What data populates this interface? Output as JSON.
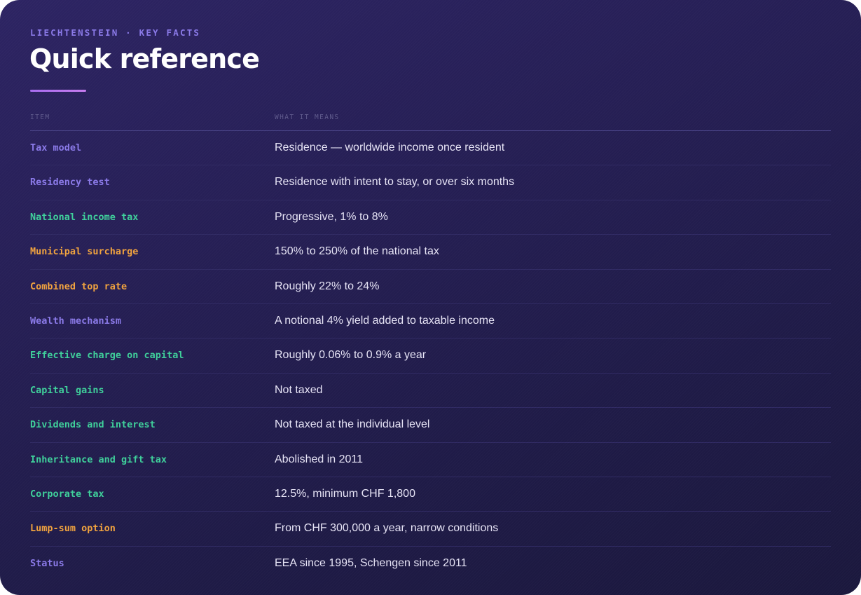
{
  "colors": {
    "purple": "#8a79e8",
    "green": "#3ecf9a",
    "orange": "#f0a23e",
    "accent_rule": "#b074f0"
  },
  "header": {
    "eyebrow": "LIECHTENSTEIN · KEY FACTS",
    "title": "Quick reference"
  },
  "table": {
    "columns": [
      "ITEM",
      "WHAT IT MEANS"
    ],
    "rows": [
      {
        "item": "Tax model",
        "meaning": "Residence — worldwide income once resident",
        "color": "#8a79e8"
      },
      {
        "item": "Residency test",
        "meaning": "Residence with intent to stay, or over six months",
        "color": "#8a79e8"
      },
      {
        "item": "National income tax",
        "meaning": "Progressive, 1% to 8%",
        "color": "#3ecf9a"
      },
      {
        "item": "Municipal surcharge",
        "meaning": "150% to 250% of the national tax",
        "color": "#f0a23e"
      },
      {
        "item": "Combined top rate",
        "meaning": "Roughly 22% to 24%",
        "color": "#f0a23e"
      },
      {
        "item": "Wealth mechanism",
        "meaning": "A notional 4% yield added to taxable income",
        "color": "#8a79e8"
      },
      {
        "item": "Effective charge on capital",
        "meaning": "Roughly 0.06% to 0.9% a year",
        "color": "#3ecf9a"
      },
      {
        "item": "Capital gains",
        "meaning": "Not taxed",
        "color": "#3ecf9a"
      },
      {
        "item": "Dividends and interest",
        "meaning": "Not taxed at the individual level",
        "color": "#3ecf9a"
      },
      {
        "item": "Inheritance and gift tax",
        "meaning": "Abolished in 2011",
        "color": "#3ecf9a"
      },
      {
        "item": "Corporate tax",
        "meaning": "12.5%, minimum CHF 1,800",
        "color": "#3ecf9a"
      },
      {
        "item": "Lump-sum option",
        "meaning": "From CHF 300,000 a year, narrow conditions",
        "color": "#f0a23e"
      },
      {
        "item": "Status",
        "meaning": "EEA since 1995, Schengen since 2011",
        "color": "#8a79e8"
      }
    ]
  }
}
